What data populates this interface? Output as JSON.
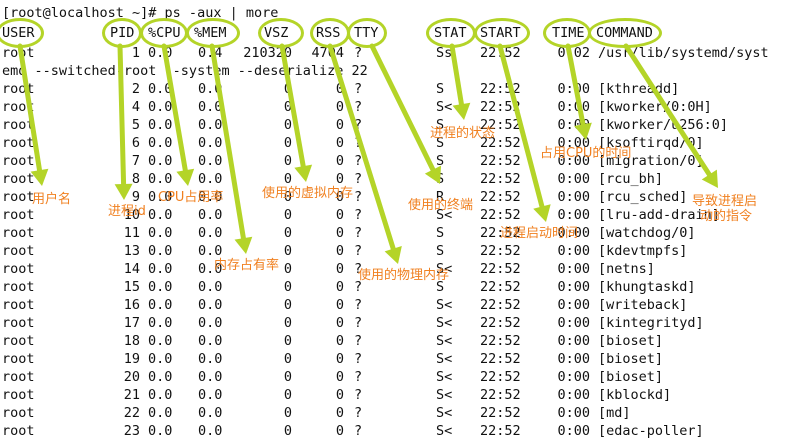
{
  "terminal": {
    "prompt": "[root@localhost ~]# ps -aux | more",
    "headers": [
      "USER",
      "PID",
      "%CPU",
      "%MEM",
      "VSZ",
      "RSS",
      "TTY",
      "STAT",
      "START",
      "TIME",
      "COMMAND"
    ],
    "wrapped_line": "emd --switched-root --system --deserialize 22",
    "rows": [
      {
        "user": "root",
        "pid": "1",
        "cpu": "0.0",
        "mem": "0.4",
        "vsz": "210320",
        "rss": "4704",
        "tty": "?",
        "stat": "Ss",
        "start": "22:52",
        "time": "0:02",
        "cmd": "/usr/lib/systemd/syst"
      },
      {
        "user": "root",
        "pid": "2",
        "cpu": "0.0",
        "mem": "0.0",
        "vsz": "0",
        "rss": "0",
        "tty": "?",
        "stat": "S",
        "start": "22:52",
        "time": "0:00",
        "cmd": "[kthreadd]"
      },
      {
        "user": "root",
        "pid": "4",
        "cpu": "0.0",
        "mem": "0.0",
        "vsz": "0",
        "rss": "0",
        "tty": "?",
        "stat": "S<",
        "start": "22:52",
        "time": "0:00",
        "cmd": "[kworker/0:0H]"
      },
      {
        "user": "root",
        "pid": "5",
        "cpu": "0.0",
        "mem": "0.0",
        "vsz": "0",
        "rss": "0",
        "tty": "?",
        "stat": "S",
        "start": "22:52",
        "time": "0:00",
        "cmd": "[kworker/u256:0]"
      },
      {
        "user": "root",
        "pid": "6",
        "cpu": "0.0",
        "mem": "0.0",
        "vsz": "0",
        "rss": "0",
        "tty": "?",
        "stat": "S",
        "start": "22:52",
        "time": "0:00",
        "cmd": "[ksoftirqd/0]"
      },
      {
        "user": "root",
        "pid": "7",
        "cpu": "0.0",
        "mem": "0.0",
        "vsz": "0",
        "rss": "0",
        "tty": "?",
        "stat": "S",
        "start": "22:52",
        "time": "0:00",
        "cmd": "[migration/0]"
      },
      {
        "user": "root",
        "pid": "8",
        "cpu": "0.0",
        "mem": "0.0",
        "vsz": "0",
        "rss": "0",
        "tty": "?",
        "stat": "S",
        "start": "22:52",
        "time": "0:00",
        "cmd": "[rcu_bh]"
      },
      {
        "user": "root",
        "pid": "9",
        "cpu": "0.0",
        "mem": "0.0",
        "vsz": "0",
        "rss": "0",
        "tty": "?",
        "stat": "R",
        "start": "22:52",
        "time": "0:00",
        "cmd": "[rcu_sched]"
      },
      {
        "user": "root",
        "pid": "10",
        "cpu": "0.0",
        "mem": "0.0",
        "vsz": "0",
        "rss": "0",
        "tty": "?",
        "stat": "S<",
        "start": "22:52",
        "time": "0:00",
        "cmd": "[lru-add-drain]"
      },
      {
        "user": "root",
        "pid": "11",
        "cpu": "0.0",
        "mem": "0.0",
        "vsz": "0",
        "rss": "0",
        "tty": "?",
        "stat": "S",
        "start": "22:52",
        "time": "0:00",
        "cmd": "[watchdog/0]"
      },
      {
        "user": "root",
        "pid": "13",
        "cpu": "0.0",
        "mem": "0.0",
        "vsz": "0",
        "rss": "0",
        "tty": "?",
        "stat": "S",
        "start": "22:52",
        "time": "0:00",
        "cmd": "[kdevtmpfs]"
      },
      {
        "user": "root",
        "pid": "14",
        "cpu": "0.0",
        "mem": "0.0",
        "vsz": "0",
        "rss": "0",
        "tty": "?",
        "stat": "S<",
        "start": "22:52",
        "time": "0:00",
        "cmd": "[netns]"
      },
      {
        "user": "root",
        "pid": "15",
        "cpu": "0.0",
        "mem": "0.0",
        "vsz": "0",
        "rss": "0",
        "tty": "?",
        "stat": "S",
        "start": "22:52",
        "time": "0:00",
        "cmd": "[khungtaskd]"
      },
      {
        "user": "root",
        "pid": "16",
        "cpu": "0.0",
        "mem": "0.0",
        "vsz": "0",
        "rss": "0",
        "tty": "?",
        "stat": "S<",
        "start": "22:52",
        "time": "0:00",
        "cmd": "[writeback]"
      },
      {
        "user": "root",
        "pid": "17",
        "cpu": "0.0",
        "mem": "0.0",
        "vsz": "0",
        "rss": "0",
        "tty": "?",
        "stat": "S<",
        "start": "22:52",
        "time": "0:00",
        "cmd": "[kintegrityd]"
      },
      {
        "user": "root",
        "pid": "18",
        "cpu": "0.0",
        "mem": "0.0",
        "vsz": "0",
        "rss": "0",
        "tty": "?",
        "stat": "S<",
        "start": "22:52",
        "time": "0:00",
        "cmd": "[bioset]"
      },
      {
        "user": "root",
        "pid": "19",
        "cpu": "0.0",
        "mem": "0.0",
        "vsz": "0",
        "rss": "0",
        "tty": "?",
        "stat": "S<",
        "start": "22:52",
        "time": "0:00",
        "cmd": "[bioset]"
      },
      {
        "user": "root",
        "pid": "20",
        "cpu": "0.0",
        "mem": "0.0",
        "vsz": "0",
        "rss": "0",
        "tty": "?",
        "stat": "S<",
        "start": "22:52",
        "time": "0:00",
        "cmd": "[bioset]"
      },
      {
        "user": "root",
        "pid": "21",
        "cpu": "0.0",
        "mem": "0.0",
        "vsz": "0",
        "rss": "0",
        "tty": "?",
        "stat": "S<",
        "start": "22:52",
        "time": "0:00",
        "cmd": "[kblockd]"
      },
      {
        "user": "root",
        "pid": "22",
        "cpu": "0.0",
        "mem": "0.0",
        "vsz": "0",
        "rss": "0",
        "tty": "?",
        "stat": "S<",
        "start": "22:52",
        "time": "0:00",
        "cmd": "[md]"
      },
      {
        "user": "root",
        "pid": "23",
        "cpu": "0.0",
        "mem": "0.0",
        "vsz": "0",
        "rss": "0",
        "tty": "?",
        "stat": "S<",
        "start": "22:52",
        "time": "0:00",
        "cmd": "[edac-poller]"
      }
    ]
  },
  "annotations": {
    "user": "用户名",
    "pid": "进程id",
    "cpu": "CPU占用率",
    "mem": "内存占有率",
    "vsz": "使用的虚拟内存",
    "rss": "使用的物理内存",
    "tty": "使用的终端",
    "stat": "进程的状态",
    "start": "进程启动时间",
    "time": "占用CPU的时间",
    "command_line1": "导致进程启",
    "command_line2": "动的指令"
  },
  "colors": {
    "highlight": "#b4d428",
    "annotation": "#f08020",
    "text": "#111111",
    "background": "#ffffff"
  }
}
